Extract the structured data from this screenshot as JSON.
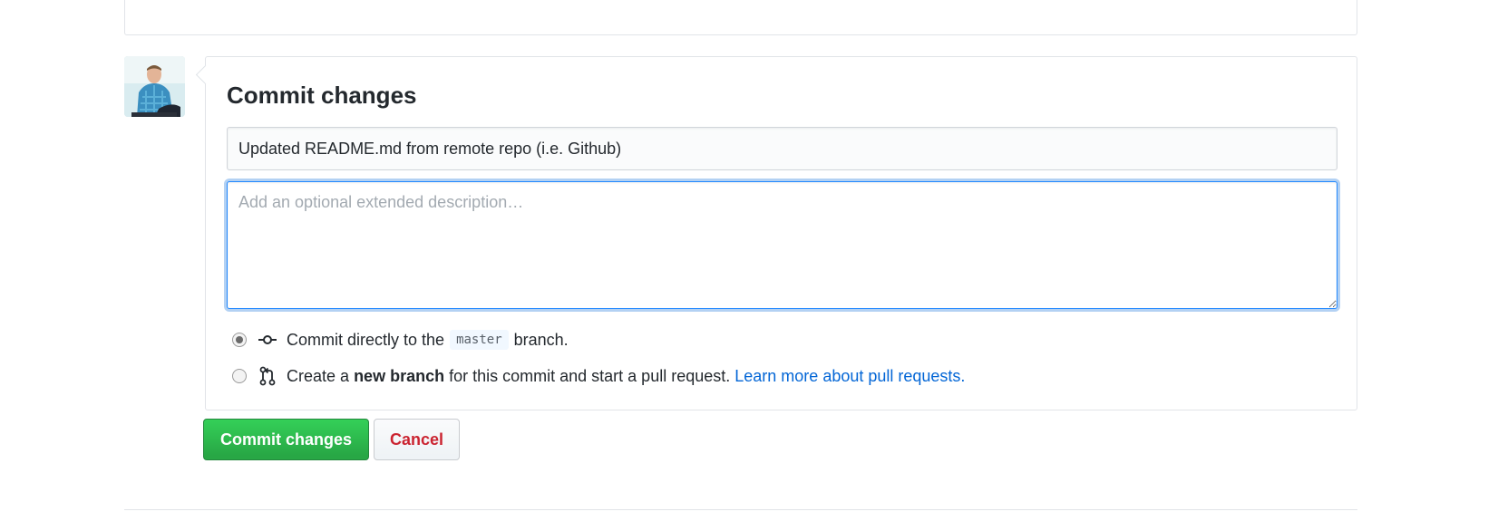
{
  "commit_form": {
    "title": "Commit changes",
    "summary_value": "Updated README.md from remote repo (i.e. Github)",
    "description_placeholder": "Add an optional extended description…",
    "description_value": "",
    "options": {
      "direct": {
        "prefix": "Commit directly to the",
        "branch": "master",
        "suffix": "branch.",
        "selected": true
      },
      "new_branch": {
        "prefix": "Create a",
        "bold": "new branch",
        "middle": "for this commit and start a pull request.",
        "link": "Learn more about pull requests.",
        "selected": false
      }
    }
  },
  "buttons": {
    "commit_label": "Commit changes",
    "cancel_label": "Cancel"
  },
  "colors": {
    "commit_green": "#28a745",
    "cancel_red": "#cb2431",
    "link_blue": "#0366d6",
    "focus_blue": "#2188ff"
  },
  "icons": {
    "avatar": "user-avatar",
    "direct": "git-commit-icon",
    "new_branch": "git-pull-request-icon"
  }
}
